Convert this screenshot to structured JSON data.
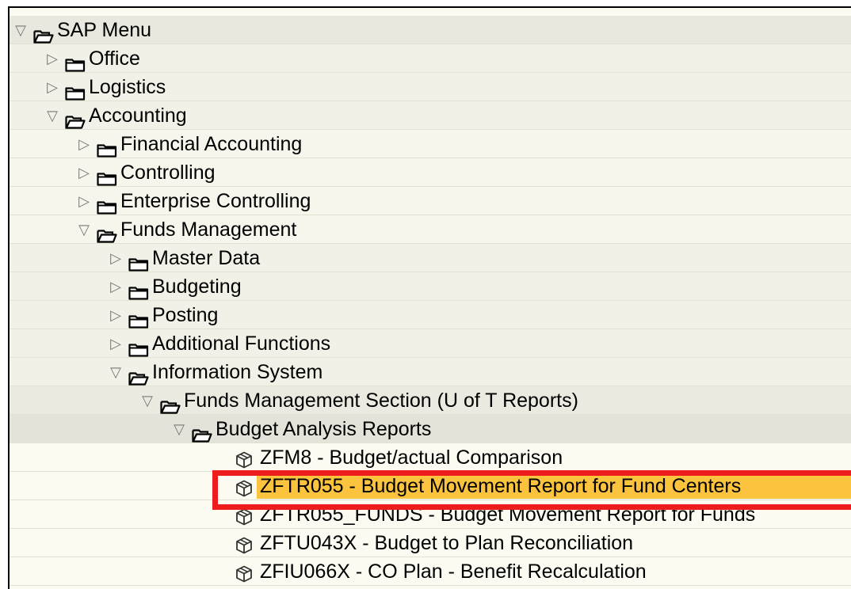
{
  "tree": {
    "rows": [
      {
        "label": "SAP Menu",
        "level": 0,
        "kind": "folder",
        "open": true,
        "bg": "#e9e8df"
      },
      {
        "label": "Office",
        "level": 1,
        "kind": "folder",
        "open": false,
        "bg": "#f2f1e7"
      },
      {
        "label": "Logistics",
        "level": 1,
        "kind": "folder",
        "open": false,
        "bg": "#f2f1e7"
      },
      {
        "label": "Accounting",
        "level": 1,
        "kind": "folder",
        "open": true,
        "bg": "#f2f1e7"
      },
      {
        "label": "Financial Accounting",
        "level": 2,
        "kind": "folder",
        "open": false,
        "bg": "#f7f6ed"
      },
      {
        "label": "Controlling",
        "level": 2,
        "kind": "folder",
        "open": false,
        "bg": "#f7f6ed"
      },
      {
        "label": "Enterprise Controlling",
        "level": 2,
        "kind": "folder",
        "open": false,
        "bg": "#f7f6ed"
      },
      {
        "label": "Funds Management",
        "level": 2,
        "kind": "folder",
        "open": true,
        "bg": "#f7f6ed"
      },
      {
        "label": "Master Data",
        "level": 3,
        "kind": "folder",
        "open": false,
        "bg": "#f2f1e7"
      },
      {
        "label": "Budgeting",
        "level": 3,
        "kind": "folder",
        "open": false,
        "bg": "#f2f1e7"
      },
      {
        "label": "Posting",
        "level": 3,
        "kind": "folder",
        "open": false,
        "bg": "#f2f1e7"
      },
      {
        "label": "Additional Functions",
        "level": 3,
        "kind": "folder",
        "open": false,
        "bg": "#f2f1e7"
      },
      {
        "label": "Information System",
        "level": 3,
        "kind": "folder",
        "open": true,
        "bg": "#f2f1e7"
      },
      {
        "label": "Funds Management Section (U of T Reports)",
        "level": 4,
        "kind": "folder",
        "open": true,
        "bg": "#ebeae0"
      },
      {
        "label": "Budget Analysis Reports",
        "level": 5,
        "kind": "folder",
        "open": true,
        "bg": "#e4e3d9"
      },
      {
        "label": "ZFM8 - Budget/actual Comparison",
        "level": 6,
        "kind": "transaction",
        "selected": false,
        "bg": "#fbfbf1"
      },
      {
        "label": "ZFTR055 - Budget Movement Report for Fund Centers",
        "level": 6,
        "kind": "transaction",
        "selected": true,
        "bg": "#fbfbf1"
      },
      {
        "label": "ZFTR055_FUNDS - Budget Movement Report for Funds",
        "level": 6,
        "kind": "transaction",
        "selected": false,
        "bg": "#fbfbf1"
      },
      {
        "label": "ZFTU043X - Budget to Plan Reconciliation",
        "level": 6,
        "kind": "transaction",
        "selected": false,
        "bg": "#fbfbf1"
      },
      {
        "label": "ZFIU066X - CO Plan - Benefit Recalculation",
        "level": 6,
        "kind": "transaction",
        "selected": false,
        "bg": "#fbfbf1"
      }
    ]
  },
  "colors": {
    "highlight": "#fbc33e",
    "annotation_box": "#ee1c1c",
    "panel_bg": "#fbfbf1"
  }
}
